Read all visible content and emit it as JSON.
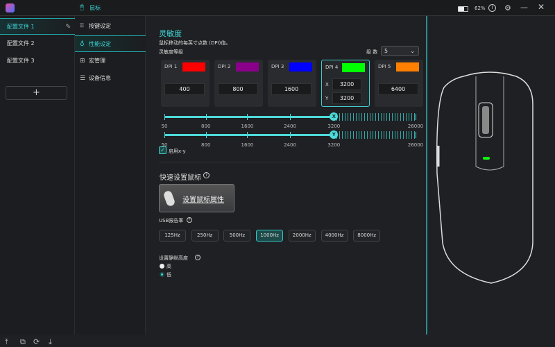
{
  "titlebar": {
    "section": "鼠标",
    "battery": "62%"
  },
  "profiles": [
    {
      "label": "配置文件 1"
    },
    {
      "label": "配置文件 2"
    },
    {
      "label": "配置文件 3"
    }
  ],
  "add_profile": "+",
  "nav": [
    {
      "label": "按键设定"
    },
    {
      "label": "性能设定"
    },
    {
      "label": "宏管理"
    },
    {
      "label": "设备信息"
    }
  ],
  "sensitivity": {
    "title": "灵敏度",
    "desc": "鼠标移动的每英寸点数 (DPI)值。",
    "levels_label": "灵敏度等级",
    "count_label": "级 数",
    "count_value": "5",
    "dpi": [
      {
        "label": "DPI 1",
        "color": "#ff0000",
        "value": "400"
      },
      {
        "label": "DPI 2",
        "color": "#8b008b",
        "value": "800"
      },
      {
        "label": "DPI 3",
        "color": "#0000ff",
        "value": "1600"
      },
      {
        "label": "DPI 4",
        "color": "#00ff00",
        "x_label": "X",
        "y_label": "Y",
        "x": "3200",
        "y": "3200"
      },
      {
        "label": "DPI 5",
        "color": "#ff8000",
        "value": "6400"
      }
    ],
    "ticks": [
      "50",
      "800",
      "1600",
      "2400",
      "3200",
      "26000"
    ],
    "slider_x": {
      "thumb": "X",
      "value": 3200
    },
    "slider_y": {
      "thumb": "Y",
      "value": 3200
    },
    "enable_xy": "启用x-y"
  },
  "quick": {
    "title": "快速设置鼠标",
    "button": "设置鼠标属性"
  },
  "usb": {
    "label": "USB报告率",
    "rates": [
      "125Hz",
      "250Hz",
      "500Hz",
      "1000Hz",
      "2000Hz",
      "4000Hz",
      "8000Hz"
    ],
    "selected": "1000Hz"
  },
  "lod": {
    "label": "设置静默高度",
    "options": [
      "高",
      "低"
    ],
    "selected": "低"
  },
  "accent": "#3fd4d4"
}
